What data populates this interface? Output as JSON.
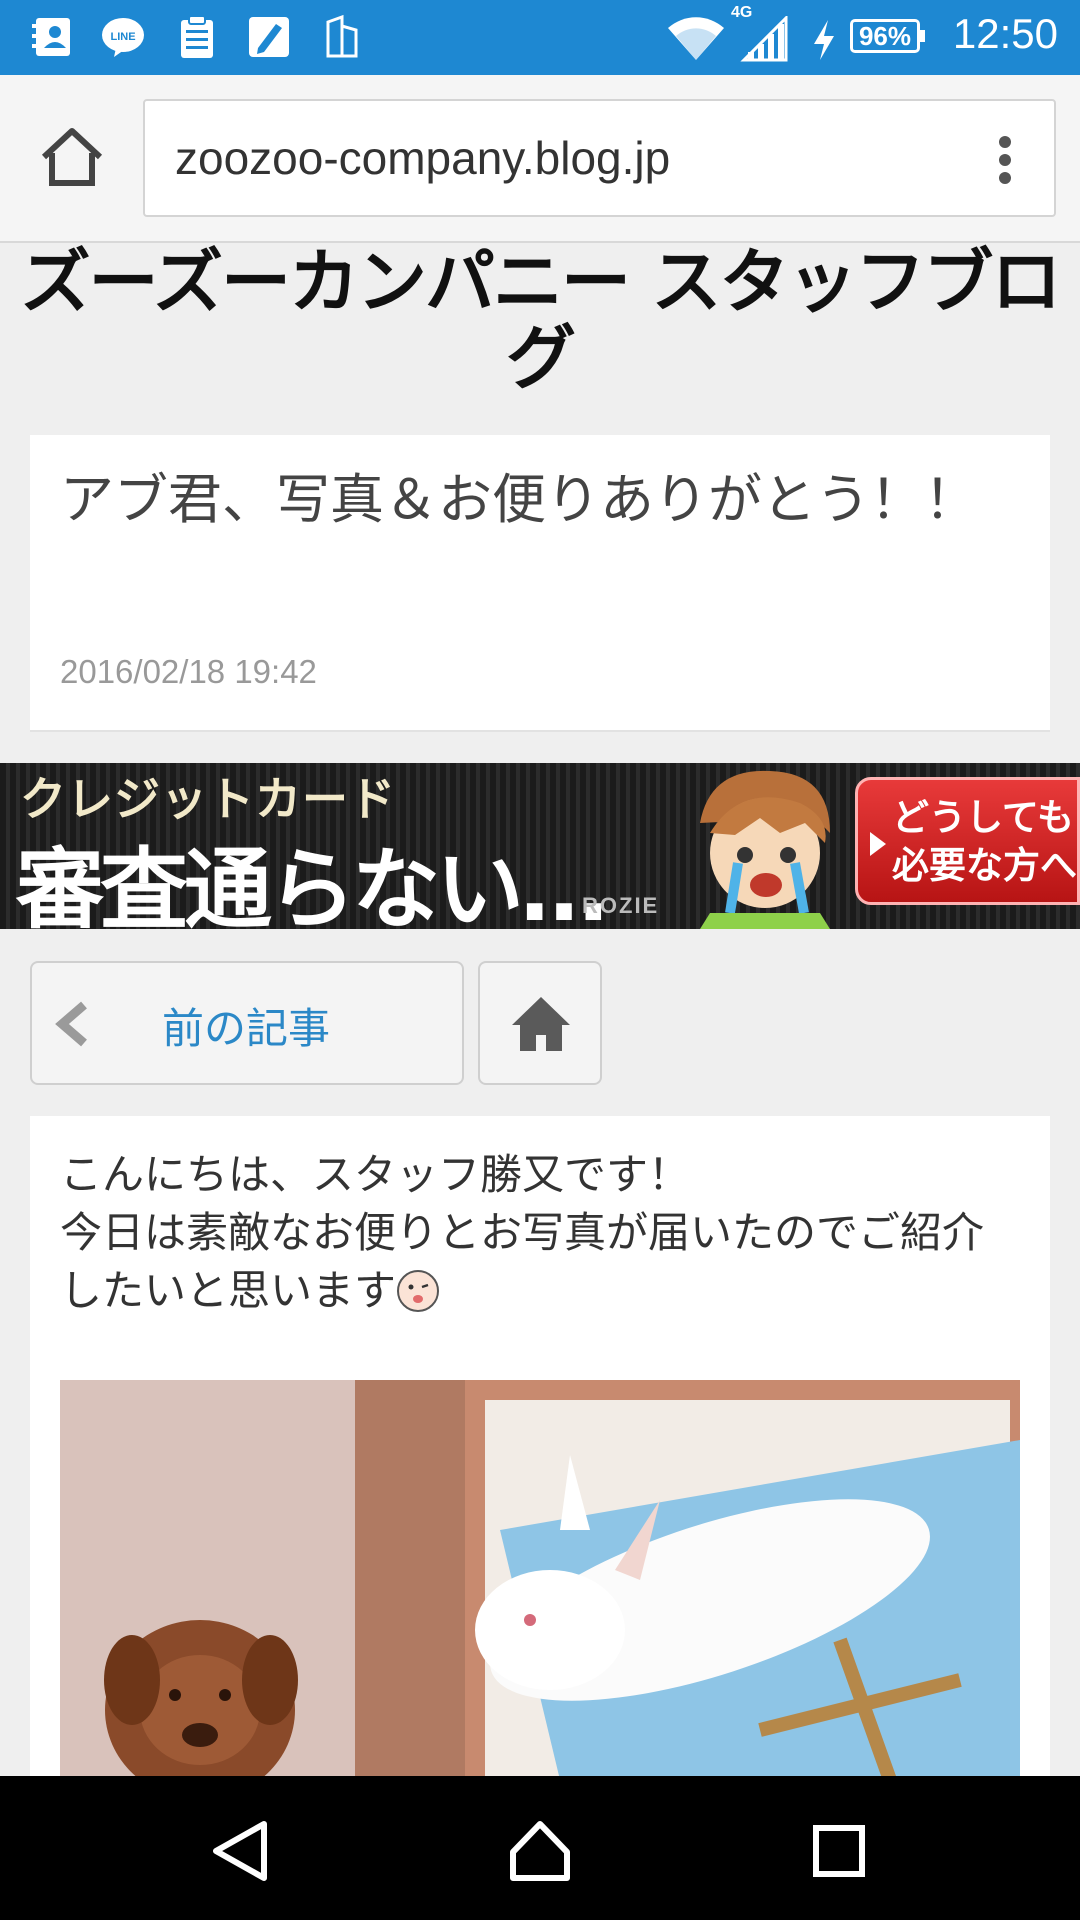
{
  "status_bar": {
    "time": "12:50",
    "battery": "96%",
    "network": "4G",
    "notification_icons": [
      "contacts-icon",
      "line-app-icon",
      "clipboard-icon",
      "pen-icon",
      "building-icon"
    ],
    "background_color": "#1e88d2"
  },
  "browser": {
    "url": "zoozoo-company.blog.jp",
    "home_icon": "home-icon",
    "menu_icon": "more-vert-icon"
  },
  "blog": {
    "title": "ズーズーカンパニー スタッフブログ"
  },
  "post": {
    "title": "アブ君、写真＆お便りありがとう！！",
    "date": "2016/02/18 19:42"
  },
  "ad": {
    "line1": "クレジットカード",
    "line2": "審査通らない…",
    "brand": "ROZIE",
    "cta": "どうしても必要な方へ"
  },
  "nav": {
    "prev_label": "前の記事",
    "home_icon": "home-icon"
  },
  "content": {
    "line1": "こんにちは、スタッフ勝又です！",
    "line2": "今日は素敵なお便りとお写真が届いたのでご紹介したいと思います"
  },
  "system_nav": {
    "icons": [
      "back-icon",
      "home-icon",
      "recents-icon"
    ]
  },
  "colors": {
    "link": "#2b88c7",
    "ad_cta": "#d62828",
    "page_background": "#efefef"
  }
}
